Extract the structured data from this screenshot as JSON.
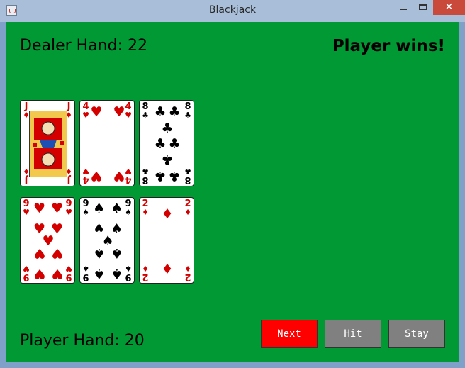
{
  "window": {
    "title": "Blackjack",
    "close_glyph": "✕"
  },
  "dealer": {
    "label": "Dealer Hand: 22",
    "cards": [
      {
        "rank": "J",
        "suit": "♦",
        "color": "red"
      },
      {
        "rank": "4",
        "suit": "♥",
        "color": "red"
      },
      {
        "rank": "8",
        "suit": "♣",
        "color": "black"
      }
    ]
  },
  "player": {
    "label": "Player Hand: 20",
    "cards": [
      {
        "rank": "9",
        "suit": "♥",
        "color": "red"
      },
      {
        "rank": "9",
        "suit": "♠",
        "color": "black"
      },
      {
        "rank": "2",
        "suit": "♦",
        "color": "red"
      }
    ]
  },
  "result": "Player wins!",
  "buttons": {
    "next": "Next",
    "hit": "Hit",
    "stay": "Stay"
  },
  "colors": {
    "felt": "#009933",
    "next": "#ff0000",
    "inactive": "#808080"
  }
}
